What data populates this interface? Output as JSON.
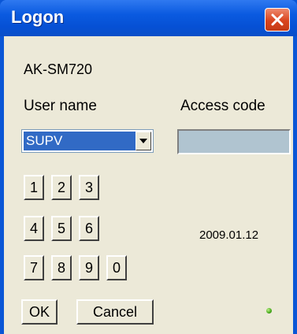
{
  "window": {
    "title": "Logon",
    "close_icon": "close-icon"
  },
  "device": {
    "model": "AK-SM720",
    "date": "2009.01.12"
  },
  "labels": {
    "user_name": "User name",
    "access_code": "Access code"
  },
  "user_select": {
    "selected": "SUPV"
  },
  "access_code_input": {
    "value": ""
  },
  "keypad": {
    "row1": [
      "1",
      "2",
      "3"
    ],
    "row2": [
      "4",
      "5",
      "6"
    ],
    "row3": [
      "7",
      "8",
      "9",
      "0"
    ]
  },
  "actions": {
    "ok": "OK",
    "cancel": "Cancel"
  },
  "status": {
    "led_color": "#44a91a",
    "icon": "status-led-icon"
  },
  "colors": {
    "titlebar": "#0a56d6",
    "close": "#d9441e",
    "selection": "#316ac5",
    "access_field": "#b0c4d0",
    "panel": "#ece9d8"
  }
}
